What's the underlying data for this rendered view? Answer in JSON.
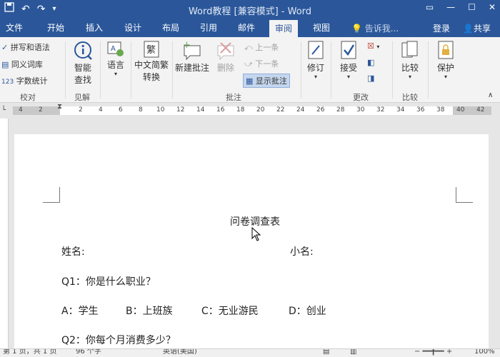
{
  "window": {
    "title": "Word教程 [兼容模式] - Word"
  },
  "tabs": [
    {
      "label": "文件"
    },
    {
      "label": "开始"
    },
    {
      "label": "插入"
    },
    {
      "label": "设计"
    },
    {
      "label": "布局"
    },
    {
      "label": "引用"
    },
    {
      "label": "邮件"
    },
    {
      "label": "审阅"
    },
    {
      "label": "视图"
    }
  ],
  "header": {
    "tell_me": "告诉我...",
    "login": "登录",
    "share": "共享"
  },
  "ribbon": {
    "proofing": {
      "spelling": "拼写和语法",
      "thesaurus": "同义词库",
      "word_count": "字数统计",
      "label": "校对"
    },
    "insights": {
      "smart_lookup_1": "智能",
      "smart_lookup_2": "查找",
      "label": "见解"
    },
    "language": {
      "label_btn": "语言"
    },
    "chinese": {
      "line1": "中文简繁",
      "line2": "转换"
    },
    "comments": {
      "new": "新建批注",
      "delete": "删除",
      "prev": "上一条",
      "next": "下一条",
      "show": "显示批注",
      "label": "批注"
    },
    "tracking": {
      "track": "修订"
    },
    "changes": {
      "accept": "接受",
      "label": "更改"
    },
    "compare": {
      "btn": "比较",
      "label": "比较"
    },
    "protect": {
      "btn": "保护"
    }
  },
  "ruler": {
    "left_numbers": [
      "4",
      "2"
    ],
    "right_numbers": [
      "2",
      "4",
      "6",
      "8",
      "10",
      "12",
      "14",
      "16",
      "18",
      "20",
      "22",
      "24",
      "26",
      "28",
      "30",
      "32",
      "34",
      "36",
      "38"
    ],
    "far_right": [
      "40",
      "42"
    ]
  },
  "document": {
    "title": "问卷调查表",
    "name_label": "姓名:",
    "nickname_label": "小名:",
    "q1": "Q1：你是什么职业？",
    "options": {
      "a": "A：学生",
      "b": "B：上班族",
      "c": "C：无业游民",
      "d": "D：创业"
    },
    "q2": "Q2：你每个月消费多少？"
  },
  "status": {
    "page": "第 1 页，共 1 页",
    "words": "96 个字",
    "language": "英语(美国)",
    "zoom": "100%"
  },
  "colors": {
    "titlebar": "#2b579a",
    "ribbon": "#f3f3f3",
    "page": "#ffffff"
  }
}
